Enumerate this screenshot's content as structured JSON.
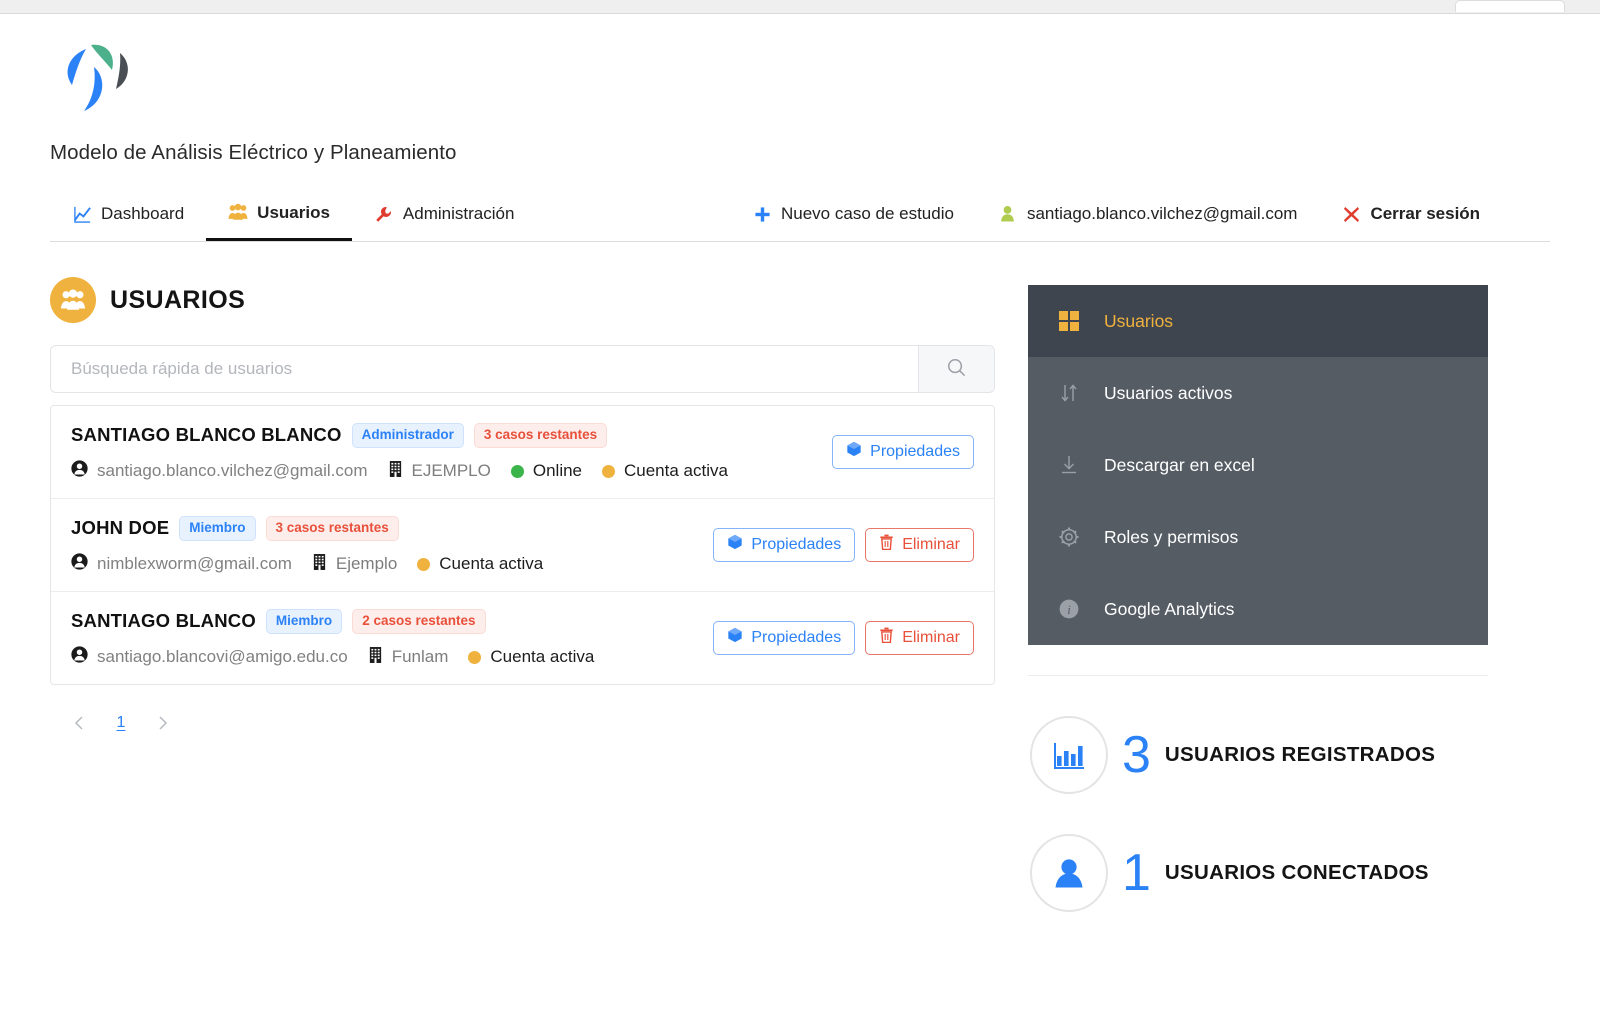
{
  "brand": {
    "title": "Modelo de Análisis Eléctrico y Planeamiento",
    "logo_colors": {
      "green": "#4cb08a",
      "gray": "#4a4f55",
      "blue": "#2b82f6"
    }
  },
  "nav": {
    "left_items": [
      {
        "label": "Dashboard",
        "icon": "line-chart-icon",
        "active": false
      },
      {
        "label": "Usuarios",
        "icon": "users-icon",
        "active": true
      },
      {
        "label": "Administración",
        "icon": "wrench-icon",
        "active": false
      }
    ],
    "right_items": [
      {
        "label": "Nuevo caso de estudio",
        "icon": "plus-icon"
      },
      {
        "label": "santiago.blanco.vilchez@gmail.com",
        "icon": "person-icon"
      },
      {
        "label": "Cerrar sesión",
        "icon": "close-x-icon"
      }
    ]
  },
  "main": {
    "section_title": "USUARIOS",
    "search": {
      "placeholder": "Búsqueda rápida de usuarios",
      "value": ""
    },
    "buttons": {
      "properties": "Propiedades",
      "delete": "Eliminar"
    },
    "users": [
      {
        "name": "SANTIAGO BLANCO BLANCO",
        "role": "Administrador",
        "cases": "3 casos restantes",
        "email": "santiago.blanco.vilchez@gmail.com",
        "org": "EJEMPLO",
        "online": "Online",
        "account": "Cuenta activa",
        "has_online": true,
        "has_delete": false
      },
      {
        "name": "JOHN DOE",
        "role": "Miembro",
        "cases": "3 casos restantes",
        "email": "nimblexworm@gmail.com",
        "org": "Ejemplo",
        "online": "",
        "account": "Cuenta activa",
        "has_online": false,
        "has_delete": true
      },
      {
        "name": "SANTIAGO BLANCO",
        "role": "Miembro",
        "cases": "2 casos restantes",
        "email": "santiago.blancovi@amigo.edu.co",
        "org": "Funlam",
        "online": "",
        "account": "Cuenta activa",
        "has_online": false,
        "has_delete": true
      }
    ],
    "pagination": {
      "prev": "‹",
      "page": "1",
      "next": "›"
    }
  },
  "sidebar": {
    "items": [
      {
        "label": "Usuarios",
        "icon": "grid-squares-icon",
        "active": true
      },
      {
        "label": "Usuarios activos",
        "icon": "sort-arrows-icon",
        "active": false
      },
      {
        "label": "Descargar en excel",
        "icon": "download-icon",
        "active": false
      },
      {
        "label": "Roles y permisos",
        "icon": "gear-icon",
        "active": false
      },
      {
        "label": "Google Analytics",
        "icon": "info-icon",
        "active": false
      }
    ],
    "stats": [
      {
        "value": "3",
        "label": "USUARIOS REGISTRADOS",
        "icon": "bar-chart-icon"
      },
      {
        "value": "1",
        "label": "USUARIOS CONECTADOS",
        "icon": "person-solid-icon"
      }
    ]
  },
  "colors": {
    "accent_blue": "#2b82f6",
    "accent_amber": "#f0b23e",
    "danger_red": "#e8503a",
    "sidebar_bg": "#555c64",
    "sidebar_active_bg": "#3f454e",
    "green": "#3bb54a"
  }
}
